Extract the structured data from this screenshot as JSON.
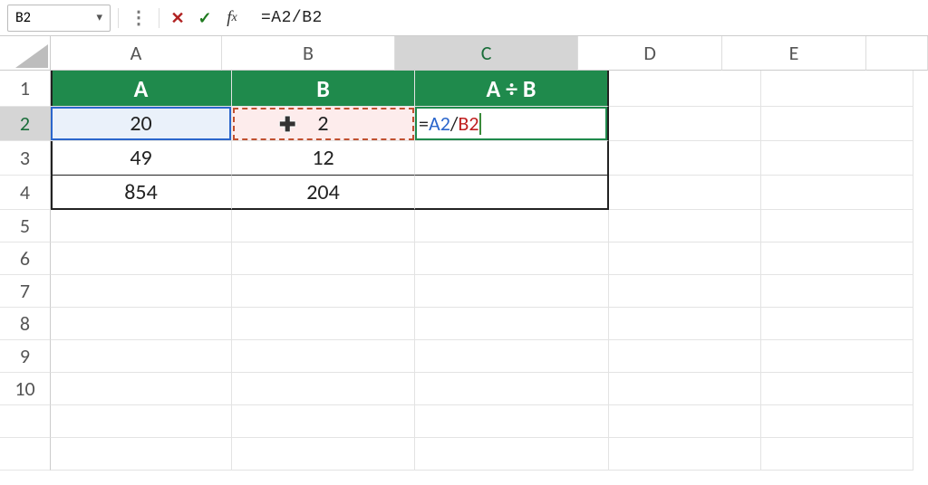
{
  "formula_bar": {
    "namebox": "B2",
    "formula": "=A2/B2"
  },
  "columns": [
    "A",
    "B",
    "C",
    "D",
    "E"
  ],
  "rows": [
    "1",
    "2",
    "3",
    "4",
    "5",
    "6",
    "7",
    "8",
    "9",
    "10"
  ],
  "headers": {
    "A": "A",
    "B": "B",
    "C": "A ÷ B"
  },
  "sheet": {
    "A2": "20",
    "B2": "2",
    "A3": "49",
    "B3": "12",
    "A4": "854",
    "B4": "204"
  },
  "edit": {
    "eq": "=",
    "refA": "A2",
    "slash": "/",
    "refB": "B2"
  },
  "selection": {
    "active_col": "C",
    "active_row": "2",
    "blue_ref": "A2",
    "dashed_ref": "B2",
    "editing": "C2"
  }
}
